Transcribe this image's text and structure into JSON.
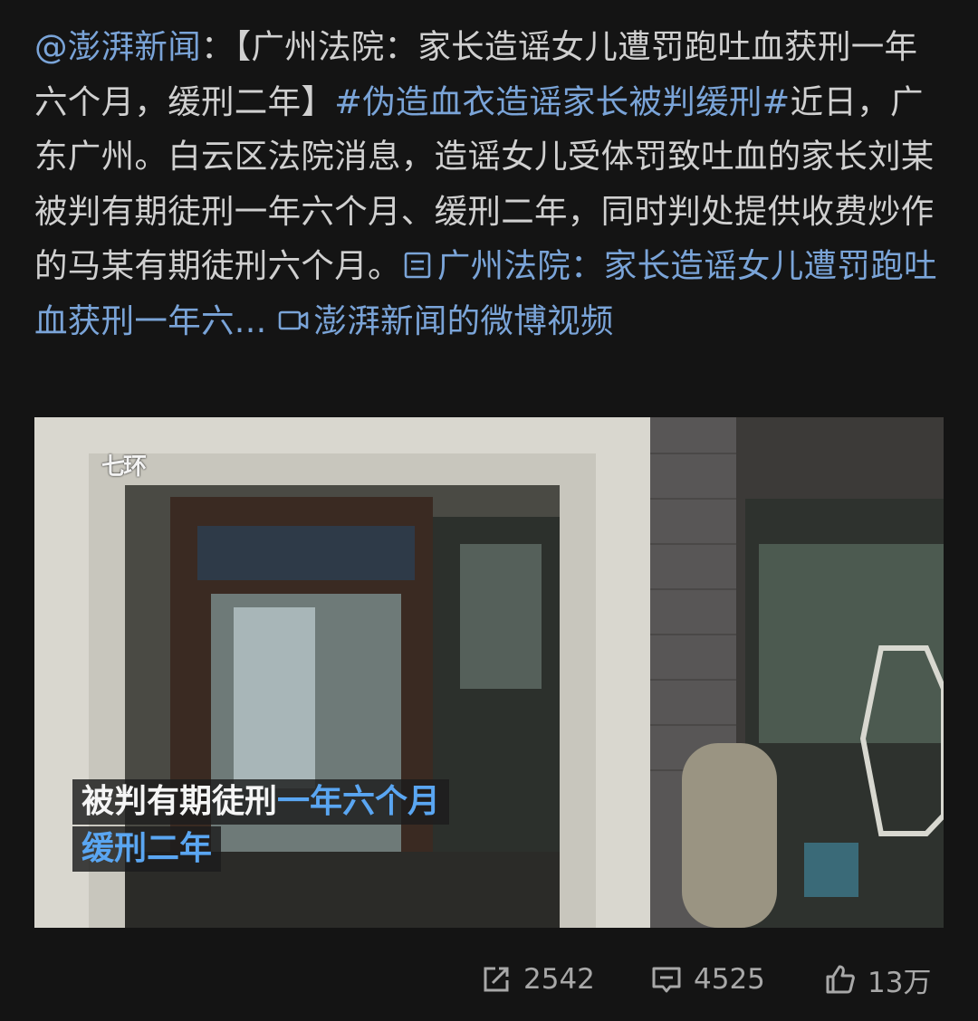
{
  "post": {
    "author": "@澎湃新闻",
    "colon": "：",
    "headline": "【广州法院：家长造谣女儿遭罚跑吐血获刑一年六个月，缓刑二年】",
    "hashtag": "#伪造血衣造谣家长被判缓刑#",
    "body": "近日，广东广州。白云区法院消息，造谣女儿受体罚致吐血的家长刘某被判有期徒刑一年六个月、缓刑二年，同时判处提供收费炒作的马某有期徒刑六个月。",
    "article_link": "广州法院：家长造谣女儿遭罚跑吐血获刑一年六...",
    "video_link": "澎湃新闻的微博视频"
  },
  "video": {
    "watermark": "七环",
    "caption_line1_white": "被判有期徒刑",
    "caption_line1_blue": "一年六个月",
    "caption_line2_blue": "缓刑二年"
  },
  "actions": {
    "repost_count": "2542",
    "comment_count": "4525",
    "like_count": "13万"
  },
  "icons": {
    "article": "document-icon",
    "video": "video-camera-icon",
    "repost": "share-arrow-icon",
    "comment": "comment-bubble-icon",
    "like": "thumbs-up-icon"
  },
  "colors": {
    "background": "#141414",
    "text": "#d0d0d0",
    "link": "#7aa4d8",
    "caption_blue": "#5aa6f2",
    "action_gray": "#a8a8a8"
  }
}
